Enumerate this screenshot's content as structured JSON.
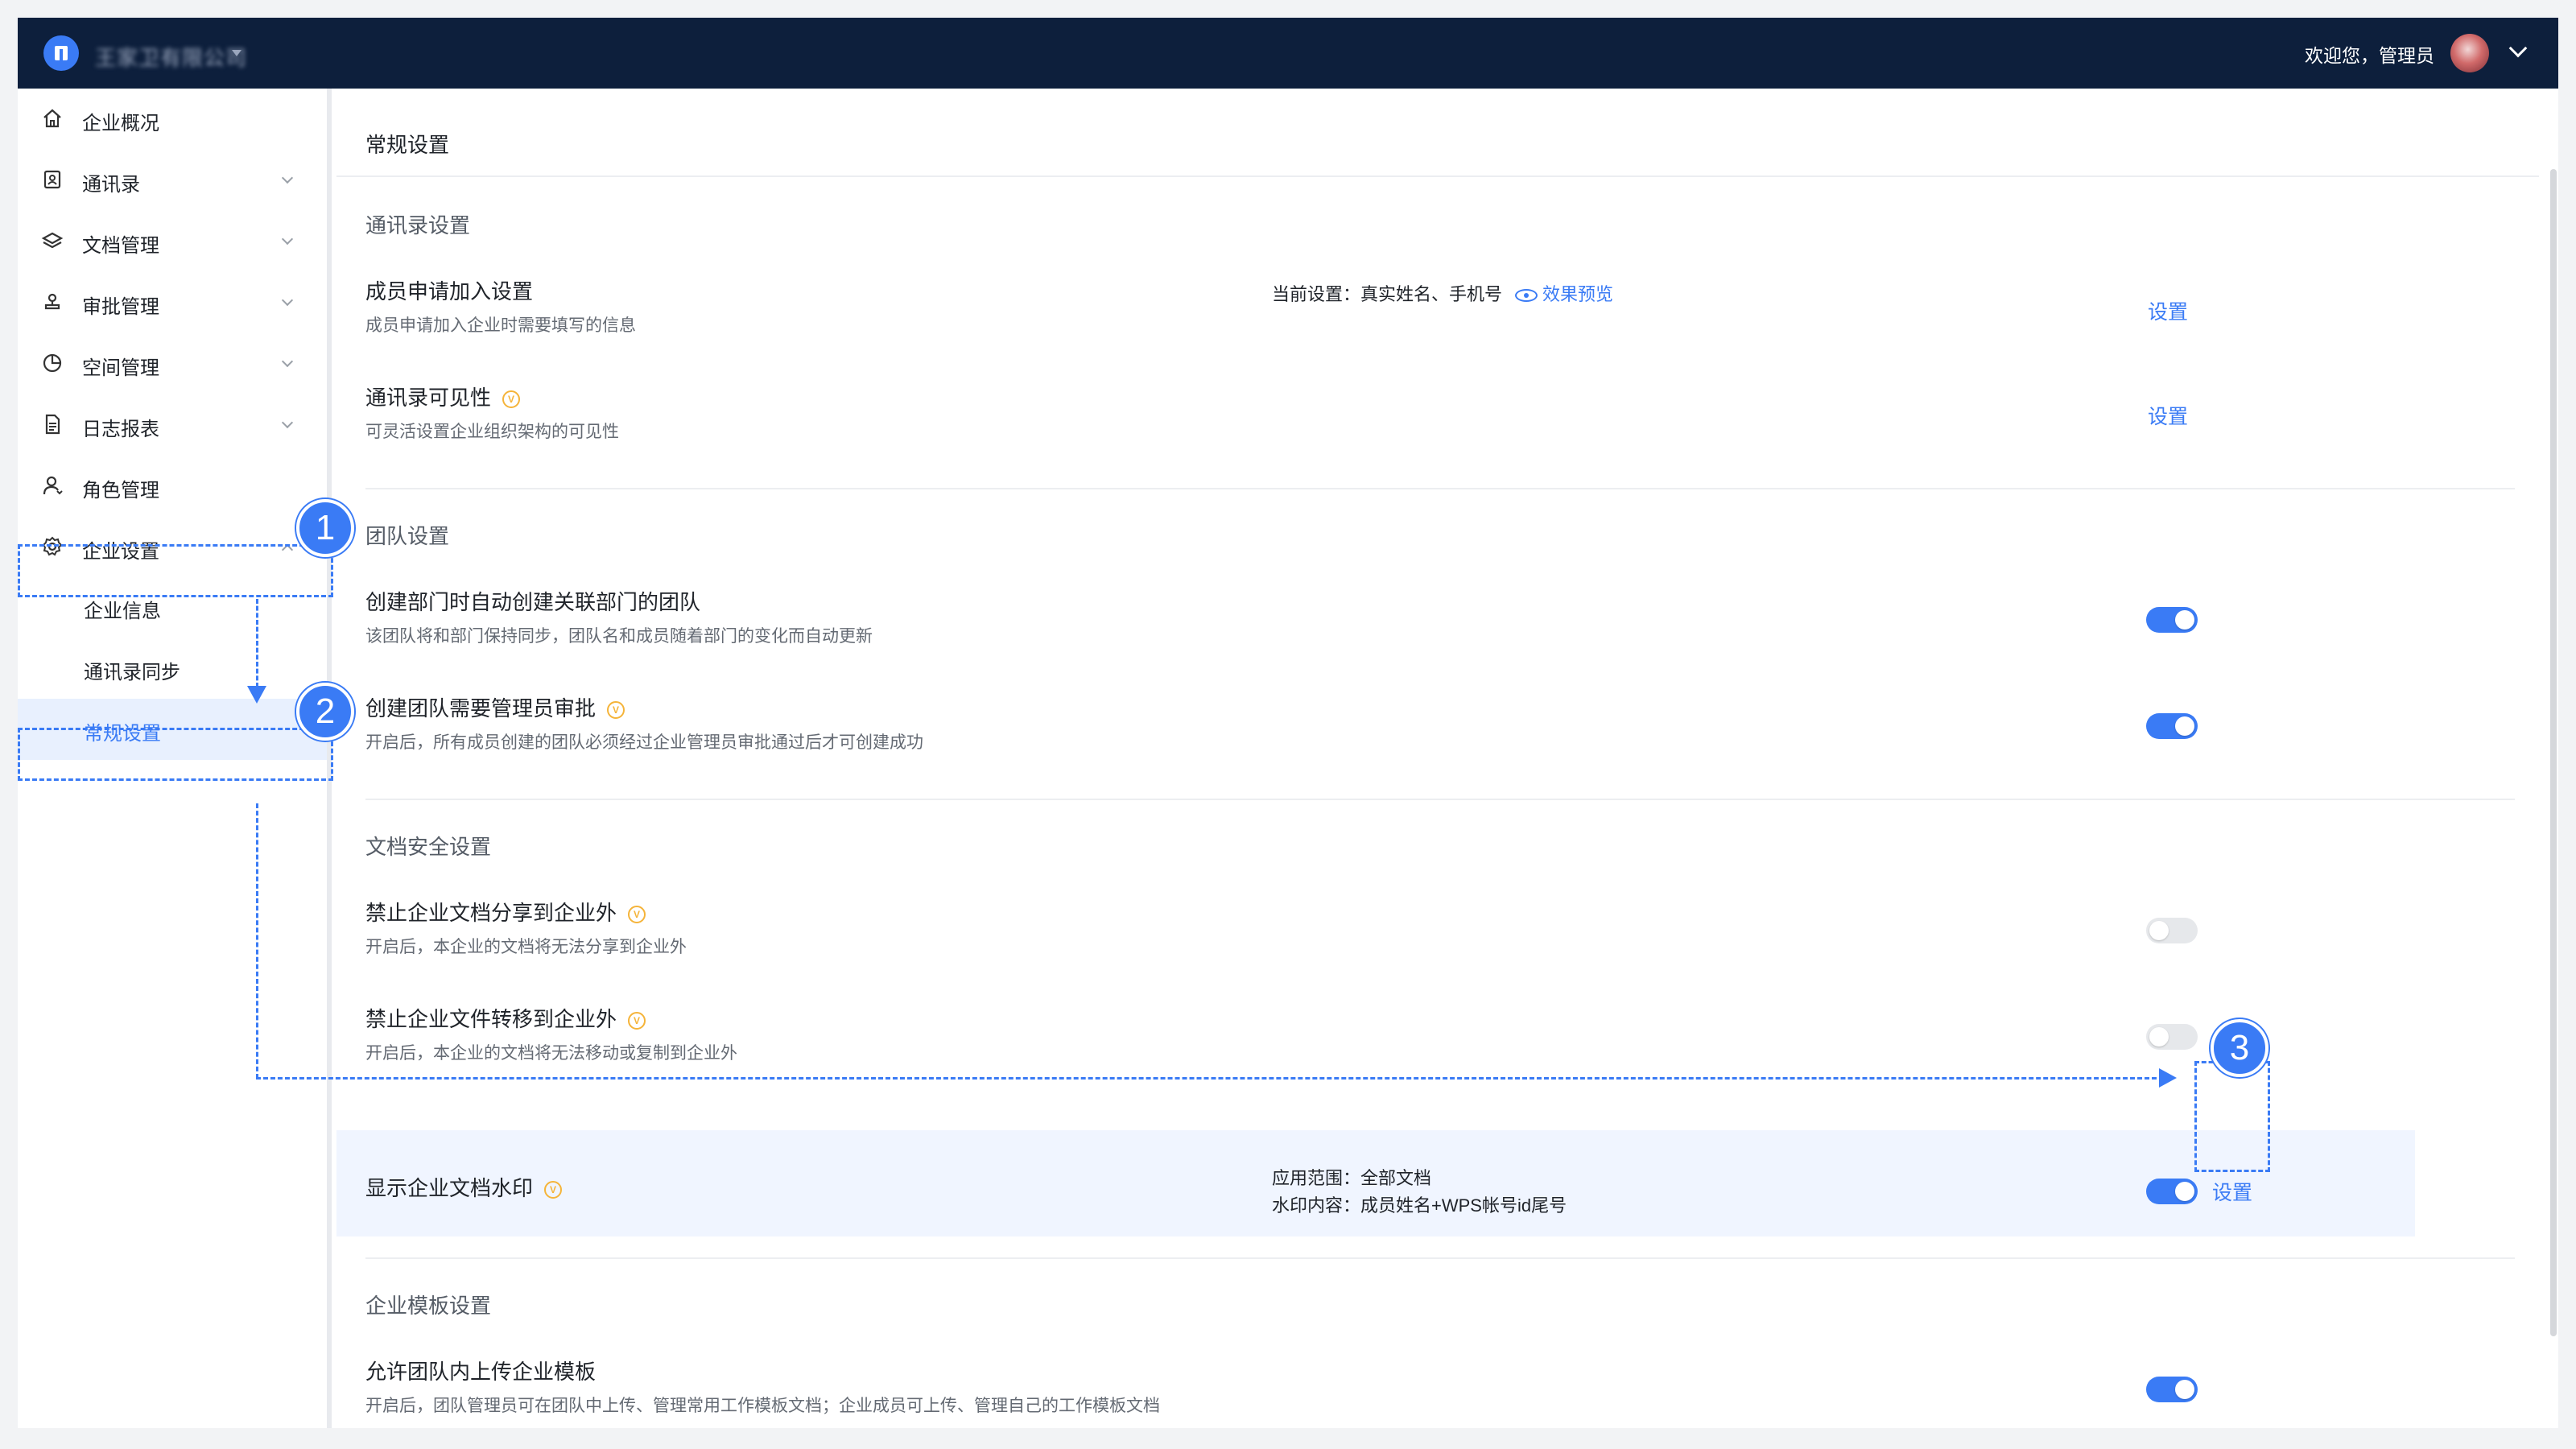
{
  "header": {
    "company_name": "王家卫有限公司",
    "welcome_text": "欢迎您，管理员"
  },
  "sidebar": {
    "items": [
      {
        "label": "企业概况",
        "icon": "home-icon"
      },
      {
        "label": "通讯录",
        "icon": "contacts-icon"
      },
      {
        "label": "文档管理",
        "icon": "layers-icon"
      },
      {
        "label": "审批管理",
        "icon": "stamp-icon"
      },
      {
        "label": "空间管理",
        "icon": "pie-chart-icon"
      },
      {
        "label": "日志报表",
        "icon": "document-icon"
      },
      {
        "label": "角色管理",
        "icon": "user-icon"
      },
      {
        "label": "企业设置",
        "icon": "gear-icon"
      }
    ],
    "sub_items": [
      {
        "label": "企业信息"
      },
      {
        "label": "通讯录同步"
      },
      {
        "label": "常规设置"
      }
    ]
  },
  "main": {
    "page_title": "常规设置",
    "sections": [
      {
        "title": "通讯录设置",
        "items": [
          {
            "title": "成员申请加入设置",
            "desc": "成员申请加入企业时需要填写的信息",
            "info": "当前设置：真实姓名、手机号",
            "preview_link": "效果预览",
            "action": "设置"
          },
          {
            "title": "通讯录可见性",
            "desc": "可灵活设置企业组织架构的可见性",
            "action": "设置"
          }
        ]
      },
      {
        "title": "团队设置",
        "items": [
          {
            "title": "创建部门时自动创建关联部门的团队",
            "desc": "该团队将和部门保持同步，团队名和成员随着部门的变化而自动更新",
            "enabled": true
          },
          {
            "title": "创建团队需要管理员审批",
            "desc": "开启后，所有成员创建的团队必须经过企业管理员审批通过后才可创建成功",
            "enabled": true
          }
        ]
      },
      {
        "title": "文档安全设置",
        "items": [
          {
            "title": "禁止企业文档分享到企业外",
            "desc": "开启后，本企业的文档将无法分享到企业外",
            "enabled": false
          },
          {
            "title": "禁止企业文件转移到企业外",
            "desc": "开启后，本企业的文档将无法移动或复制到企业外",
            "enabled": false
          },
          {
            "title": "显示企业文档水印",
            "info_line1": "应用范围：全部文档",
            "info_line2": "水印内容：成员姓名+WPS帐号id尾号",
            "enabled": true,
            "action": "设置"
          }
        ]
      },
      {
        "title": "企业模板设置",
        "items": [
          {
            "title": "允许团队内上传企业模板",
            "desc": "开启后，团队管理员可在团队中上传、管理常用工作模板文档；企业成员可上传、管理自己的工作模板文档",
            "enabled": true
          }
        ]
      }
    ]
  },
  "annotations": {
    "step1": "1",
    "step2": "2",
    "step3": "3"
  },
  "colors": {
    "accent": "#3a7bf5",
    "topbar": "#0d1f3c",
    "vip": "#f5b43a"
  }
}
